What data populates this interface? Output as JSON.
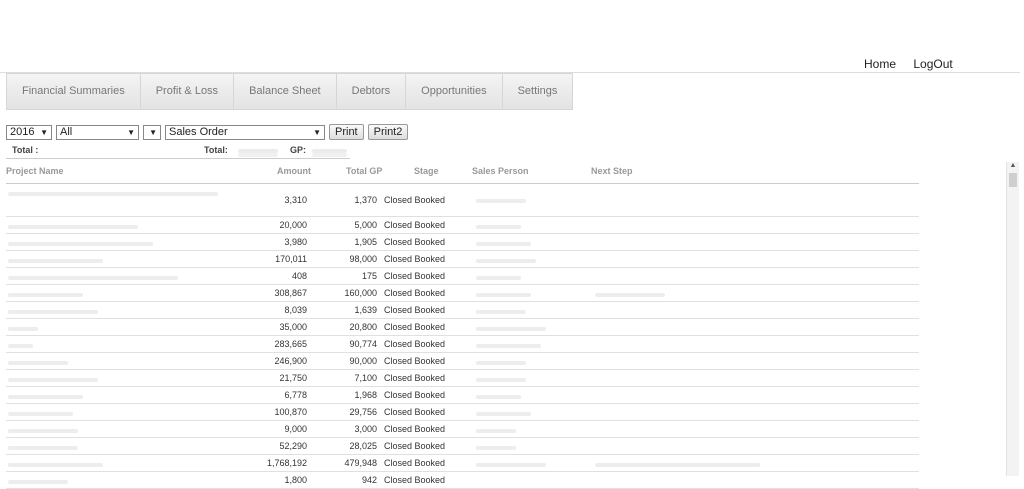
{
  "topnav": {
    "home": "Home",
    "logout": "LogOut"
  },
  "tabs": [
    "Financial Summaries",
    "Profit & Loss",
    "Balance Sheet",
    "Debtors",
    "Opportunities",
    "Settings"
  ],
  "filters": {
    "year": "2016",
    "scope": "All",
    "blank": "",
    "type": "Sales Order",
    "print": "Print",
    "print2": "Print2"
  },
  "totals": {
    "total_label": "Total :",
    "total2_label": "Total:",
    "gp_label": "GP:"
  },
  "table": {
    "headers": {
      "project": "Project Name",
      "amount": "Amount",
      "total_gp": "Total GP",
      "stage": "Stage",
      "sales_person": "Sales Person",
      "next_step": "Next Step"
    },
    "rows": [
      {
        "amount": "3,310",
        "gp": "1,370",
        "stage": "Closed Booked"
      },
      {
        "amount": "20,000",
        "gp": "5,000",
        "stage": "Closed Booked"
      },
      {
        "amount": "3,980",
        "gp": "1,905",
        "stage": "Closed Booked"
      },
      {
        "amount": "170,011",
        "gp": "98,000",
        "stage": "Closed Booked"
      },
      {
        "amount": "408",
        "gp": "175",
        "stage": "Closed Booked"
      },
      {
        "amount": "308,867",
        "gp": "160,000",
        "stage": "Closed Booked"
      },
      {
        "amount": "8,039",
        "gp": "1,639",
        "stage": "Closed Booked"
      },
      {
        "amount": "35,000",
        "gp": "20,800",
        "stage": "Closed Booked"
      },
      {
        "amount": "283,665",
        "gp": "90,774",
        "stage": "Closed Booked"
      },
      {
        "amount": "246,900",
        "gp": "90,000",
        "stage": "Closed Booked"
      },
      {
        "amount": "21,750",
        "gp": "7,100",
        "stage": "Closed Booked"
      },
      {
        "amount": "6,778",
        "gp": "1,968",
        "stage": "Closed Booked"
      },
      {
        "amount": "100,870",
        "gp": "29,756",
        "stage": "Closed Booked"
      },
      {
        "amount": "9,000",
        "gp": "3,000",
        "stage": "Closed Booked"
      },
      {
        "amount": "52,290",
        "gp": "28,025",
        "stage": "Closed Booked"
      },
      {
        "amount": "1,768,192",
        "gp": "479,948",
        "stage": "Closed Booked"
      },
      {
        "amount": "1,800",
        "gp": "942",
        "stage": "Closed Booked"
      }
    ]
  }
}
